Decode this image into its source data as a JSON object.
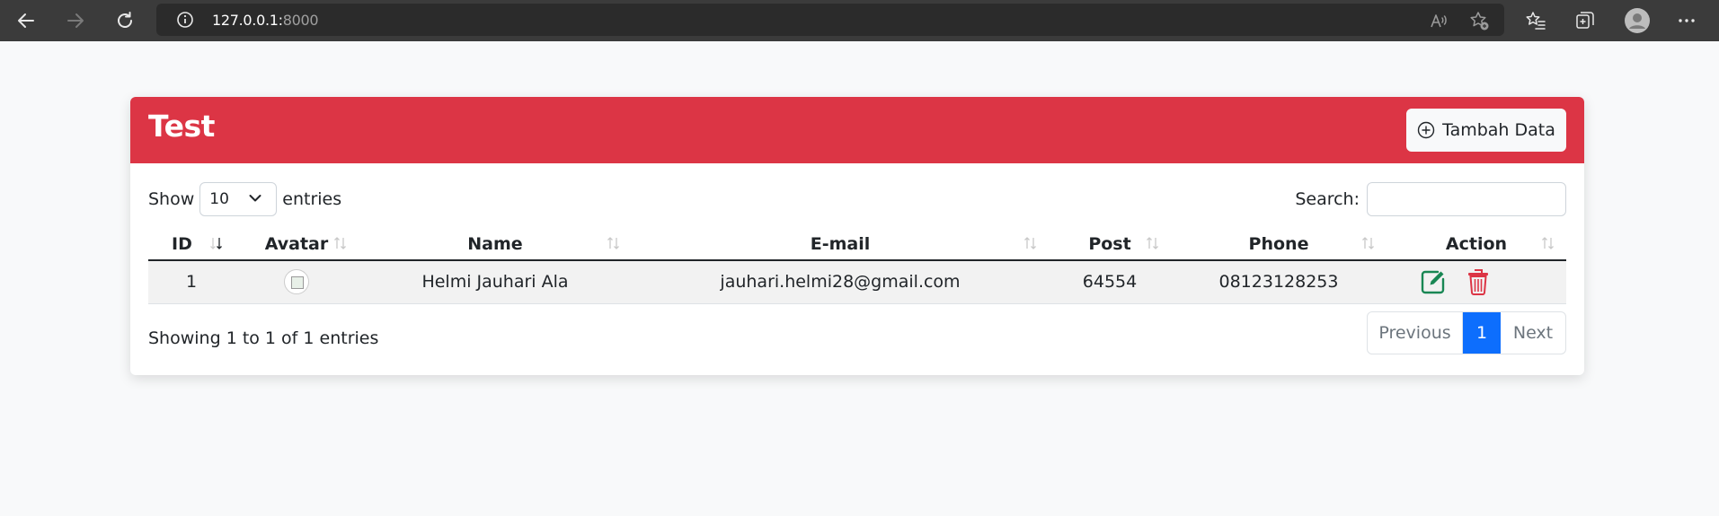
{
  "browser": {
    "url_host": "127.0.0.1:",
    "url_port": "8000"
  },
  "card": {
    "title": "Test",
    "add_button_label": "Tambah Data",
    "accent_color": "#dc3545"
  },
  "controls": {
    "show_label": "Show",
    "entries_select_value": "10",
    "entries_label": "entries",
    "search_label": "Search:",
    "search_value": ""
  },
  "table": {
    "columns": [
      "ID",
      "Avatar",
      "Name",
      "E-mail",
      "Post",
      "Phone",
      "Action"
    ],
    "rows": [
      {
        "id": "1",
        "name": "Helmi Jauhari Ala",
        "email": "jauhari.helmi28@gmail.com",
        "post": "64554",
        "phone": "08123128253"
      }
    ]
  },
  "footer": {
    "info": "Showing 1 to 1 of 1 entries",
    "prev_label": "Previous",
    "current_page": "1",
    "next_label": "Next"
  }
}
